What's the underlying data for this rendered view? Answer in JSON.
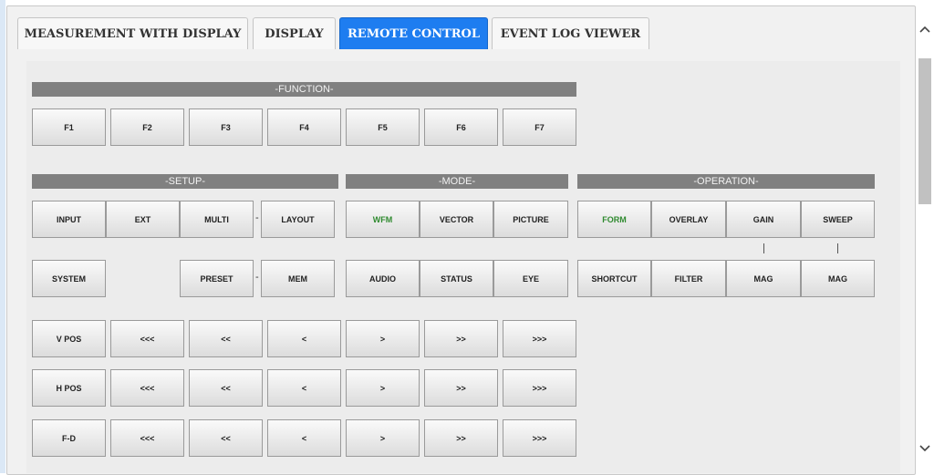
{
  "tabs": [
    {
      "label": "MEASUREMENT WITH DISPLAY",
      "active": false
    },
    {
      "label": "DISPLAY",
      "active": false
    },
    {
      "label": "REMOTE CONTROL",
      "active": true
    },
    {
      "label": "EVENT LOG VIEWER",
      "active": false
    }
  ],
  "sections": {
    "function": "-FUNCTION-",
    "setup": "-SETUP-",
    "mode": "-MODE-",
    "operation": "-OPERATION-"
  },
  "function_keys": [
    "F1",
    "F2",
    "F3",
    "F4",
    "F5",
    "F6",
    "F7"
  ],
  "setup": {
    "row1": [
      "INPUT",
      "EXT",
      "MULTI",
      "LAYOUT"
    ],
    "row2": [
      "SYSTEM",
      "PRESET",
      "MEM"
    ],
    "dash": "-"
  },
  "mode": {
    "row1": [
      "WFM",
      "VECTOR",
      "PICTURE"
    ],
    "row2": [
      "AUDIO",
      "STATUS",
      "EYE"
    ]
  },
  "operation": {
    "row1": [
      "FORM",
      "OVERLAY",
      "GAIN",
      "SWEEP"
    ],
    "row2": [
      "SHORTCUT",
      "FILTER",
      "MAG",
      "MAG"
    ]
  },
  "position_rows": [
    {
      "label": "V POS",
      "buttons": [
        "<<<",
        "<<",
        "<",
        ">",
        ">>",
        ">>>"
      ]
    },
    {
      "label": "H POS",
      "buttons": [
        "<<<",
        "<<",
        "<",
        ">",
        ">>",
        ">>>"
      ]
    },
    {
      "label": "F-D",
      "buttons": [
        "<<<",
        "<<",
        "<",
        ">",
        ">>",
        ">>>"
      ]
    }
  ],
  "colors": {
    "active_tab": "#1e7df0",
    "section_bar": "#808080",
    "highlight_text": "#2f8a2f"
  },
  "scrollbar": {
    "up_icon": "chevron-up-icon",
    "down_icon": "chevron-down-icon"
  }
}
